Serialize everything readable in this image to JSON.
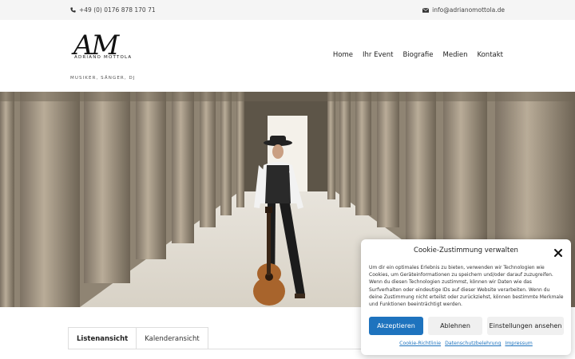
{
  "topbar": {
    "phone": "+49 (0) 0176 878 170 71",
    "email": "info@adrianomottola.de"
  },
  "logo": {
    "monogram": "AM",
    "name": "ADRIANO MOTTOLA",
    "tagline": "MUSIKER, SÄNGER, DJ"
  },
  "nav": {
    "items": [
      "Home",
      "Ihr Event",
      "Biografie",
      "Medien",
      "Kontakt"
    ]
  },
  "tabs": {
    "items": [
      "Listenansicht",
      "Kalenderansicht"
    ]
  },
  "cookie": {
    "title": "Cookie-Zustimmung verwalten",
    "text": "Um dir ein optimales Erlebnis zu bieten, verwenden wir Technologien wie Cookies, um Geräteinformationen zu speichern und/oder darauf zuzugreifen. Wenn du diesen Technologien zustimmst, können wir Daten wie das Surfverhalten oder eindeutige IDs auf dieser Website verarbeiten. Wenn du deine Zustimmung nicht erteilst oder zurückziehst, können bestimmte Merkmale und Funktionen beeinträchtigt werden.",
    "accept": "Akzeptieren",
    "deny": "Ablehnen",
    "preferences": "Einstellungen ansehen",
    "links": [
      "Cookie-Richtlinie",
      "Datenschutzbelehrung",
      "Impressum"
    ]
  },
  "colors": {
    "accent": "#1e73be",
    "topbar_bg": "#f5f5f5"
  }
}
